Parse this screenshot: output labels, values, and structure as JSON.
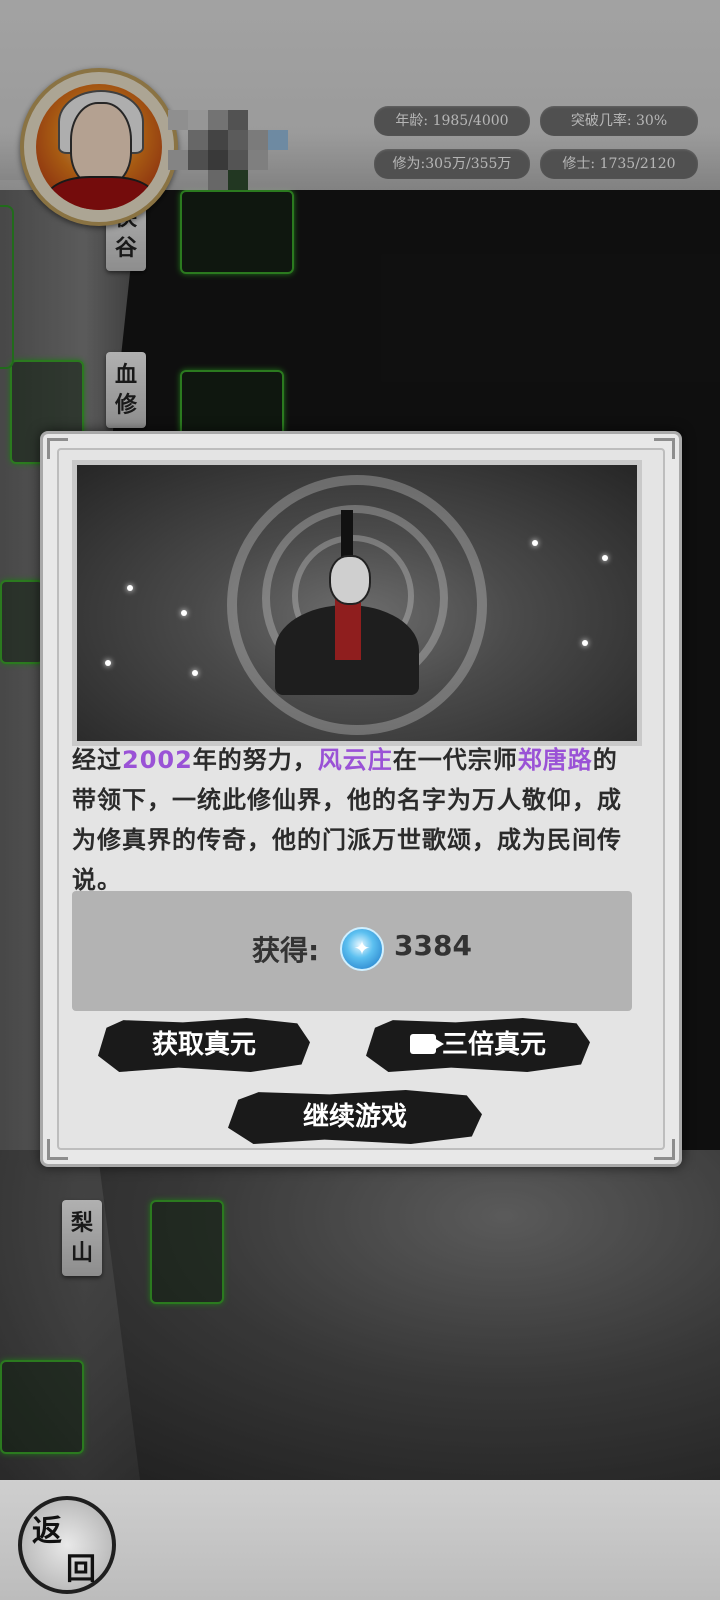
{
  "hud": {
    "age": "年龄: 1985/4000",
    "breakthrough": "突破几率:  30%",
    "cultivation": "修为:305万/355万",
    "disciples": "修士: 1735/2120"
  },
  "map": {
    "labels": [
      {
        "chars": [
          "侠",
          "谷"
        ]
      },
      {
        "chars": [
          "血",
          "修"
        ]
      },
      {
        "chars": [
          "梨",
          "山"
        ]
      }
    ]
  },
  "modal": {
    "story": {
      "p1": "经过",
      "year": "2002",
      "p2": "年的努力，",
      "sect": "风云庄",
      "p3": "在一代宗师",
      "master": "郑唐路",
      "p4": "的带领下，一统此修仙界，他的名字为万人敬仰，成为修真界的传奇，他的门派万世歌颂，成为民间传说。"
    },
    "reward": {
      "label": "获得:",
      "icon": "spirit-orb-icon",
      "value": "3384"
    },
    "buttons": {
      "claim": "获取真元",
      "triple": "三倍真元",
      "continue": "继续游戏"
    }
  },
  "footer": {
    "back_top": "返",
    "back_bottom": "回"
  },
  "colors": {
    "highlight": "#9a52d6",
    "map_green": "#3aa32a"
  }
}
